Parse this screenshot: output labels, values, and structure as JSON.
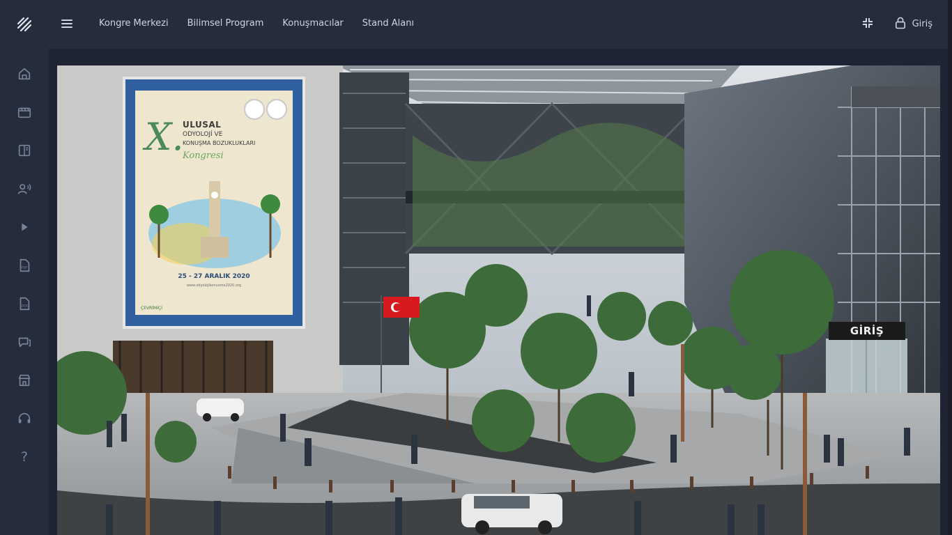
{
  "sidebar": {
    "logo_icon": "brand-logo-icon",
    "items": [
      {
        "name": "home",
        "icon": "home-icon"
      },
      {
        "name": "video",
        "icon": "clapperboard-icon"
      },
      {
        "name": "book",
        "icon": "book-icon"
      },
      {
        "name": "speakers",
        "icon": "speaker-person-icon"
      },
      {
        "name": "play",
        "icon": "play-icon"
      },
      {
        "name": "pdf",
        "icon": "pdf-file-icon"
      },
      {
        "name": "doc",
        "icon": "doc-file-icon"
      },
      {
        "name": "chat",
        "icon": "chat-icon"
      },
      {
        "name": "stand",
        "icon": "storefront-icon"
      },
      {
        "name": "support",
        "icon": "headset-icon"
      },
      {
        "name": "help",
        "icon": "question-icon",
        "glyph": "?"
      }
    ]
  },
  "header": {
    "menu_icon": "hamburger-menu-icon",
    "nav": [
      "Kongre Merkezi",
      "Bilimsel Program",
      "Konuşmacılar",
      "Stand Alanı"
    ],
    "compress_icon": "compress-icon",
    "login_icon": "lock-icon",
    "login_label": "Giriş"
  },
  "scene": {
    "description_icon": "congress-center-render",
    "poster": {
      "numeral": "X.",
      "line1": "ULUSAL",
      "line2": "ODYOLOJİ VE",
      "line3": "KONUŞMA BOZUKLUKLARI",
      "line4": "Kongresi",
      "date": "25 - 27 ARALIK 2020",
      "url": "www.odyolojikonusma2020.org",
      "badge": "ÇEVRİMİÇİ"
    },
    "entrance_sign": "GİRİŞ",
    "colors": {
      "sky": "#c9ced4",
      "building": "#3a3f45",
      "tree": "#3d6b3a",
      "pavement": "#9a9ea3",
      "flag": "#d71920"
    }
  }
}
